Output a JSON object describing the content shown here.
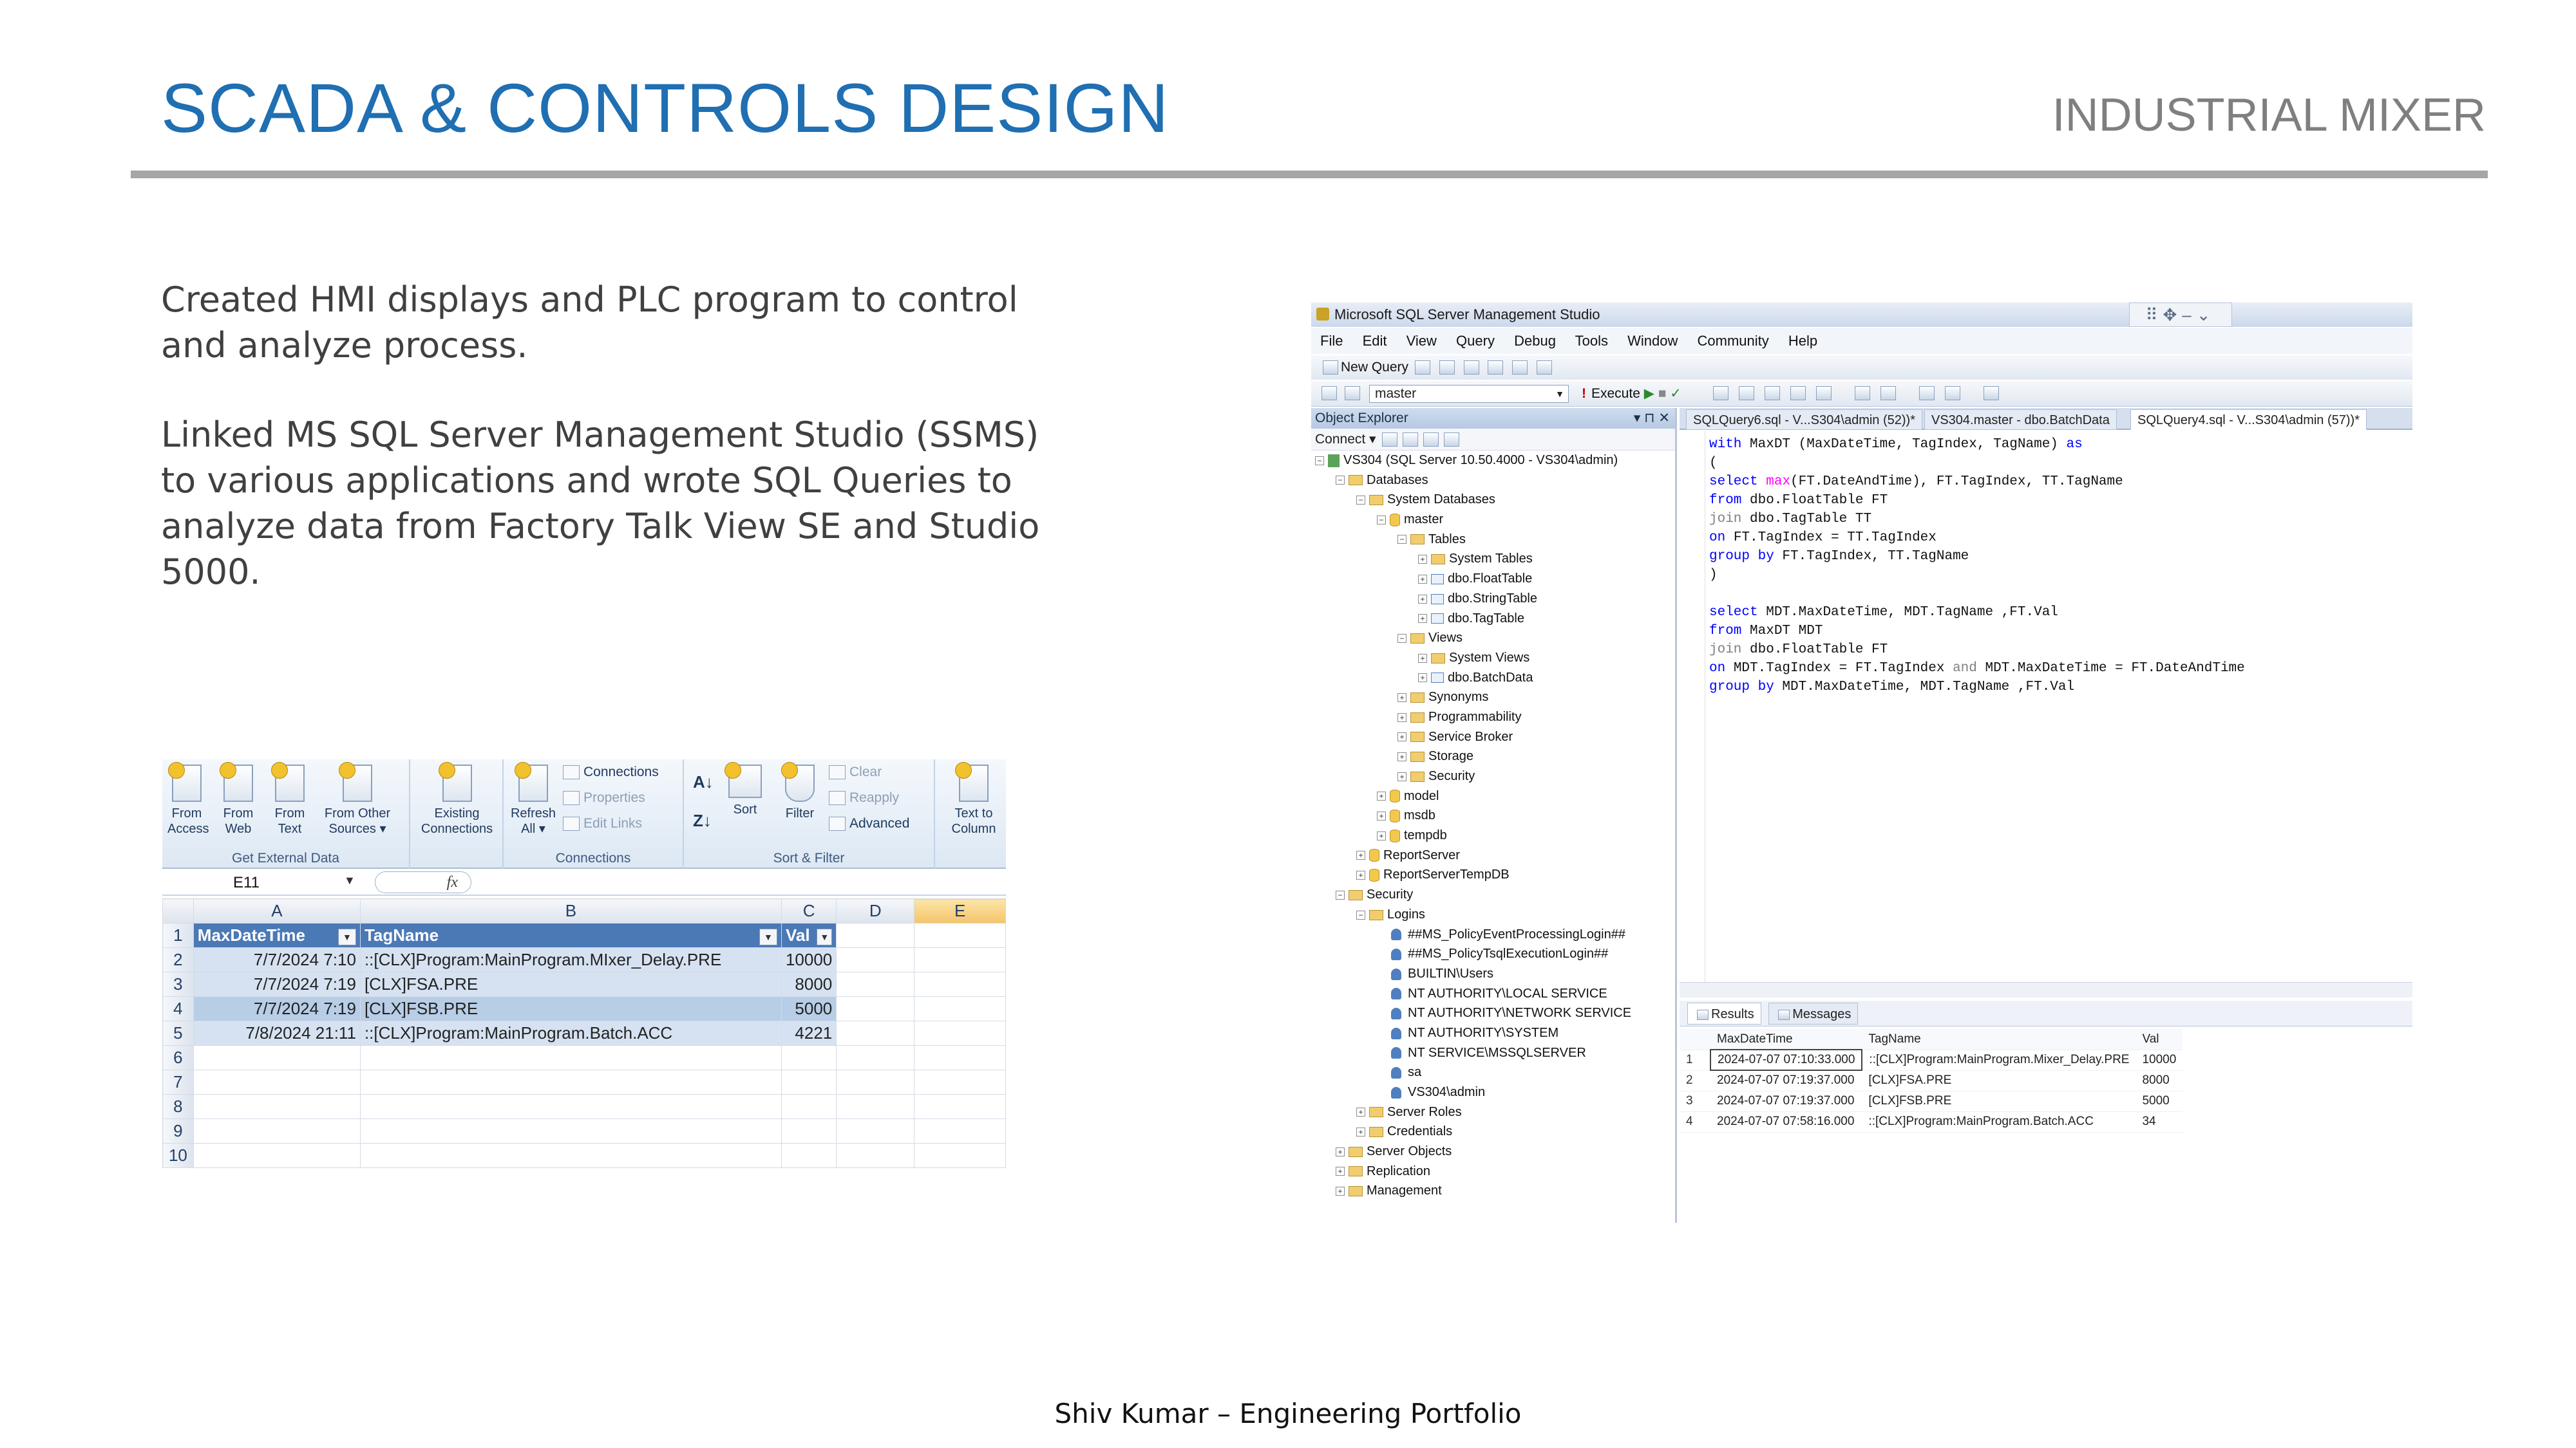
{
  "slide": {
    "title": "SCADA & CONTROLS DESIGN",
    "subtitle": "INDUSTRIAL MIXER",
    "paragraph1": "Created HMI displays and PLC program to control and analyze process.",
    "paragraph2": "Linked MS SQL Server Management Studio (SSMS) to various applications and wrote SQL Queries to analyze data from Factory Talk View SE and Studio 5000.",
    "footer": "Shiv Kumar – Engineering Portfolio"
  },
  "excel": {
    "ribbon": {
      "from_access": "From\nAccess",
      "from_web": "From\nWeb",
      "from_text": "From\nText",
      "from_other": "From Other\nSources ▾",
      "existing_connections": "Existing\nConnections",
      "get_external_label": "Get External Data",
      "refresh_all": "Refresh\nAll ▾",
      "connections": "Connections",
      "properties": "Properties",
      "edit_links": "Edit Links",
      "connections_label": "Connections",
      "sort": "Sort",
      "filter": "Filter",
      "clear": "Clear",
      "reapply": "Reapply",
      "advanced": "Advanced",
      "sort_filter_label": "Sort & Filter",
      "text_to_columns": "Text to\nColumn"
    },
    "name_box": "E11",
    "fx": "fx",
    "columns": [
      "A",
      "B",
      "C",
      "D",
      "E"
    ],
    "headers": [
      "MaxDateTime",
      "TagName",
      "Val"
    ],
    "rows": [
      [
        "7/7/2024 7:10",
        "::[CLX]Program:MainProgram.MIxer_Delay.PRE",
        "10000"
      ],
      [
        "7/7/2024 7:19",
        "[CLX]FSA.PRE",
        "8000"
      ],
      [
        "7/7/2024 7:19",
        "[CLX]FSB.PRE",
        "5000"
      ],
      [
        "7/8/2024 21:11",
        "::[CLX]Program:MainProgram.Batch.ACC",
        "4221"
      ]
    ],
    "row_numbers": [
      "1",
      "2",
      "3",
      "4",
      "5",
      "6",
      "7",
      "8",
      "9",
      "10"
    ]
  },
  "ssms": {
    "window_title": "Microsoft SQL Server Management Studio",
    "menu": [
      "File",
      "Edit",
      "View",
      "Query",
      "Debug",
      "Tools",
      "Window",
      "Community",
      "Help"
    ],
    "new_query": "New Query",
    "database": "master",
    "execute": "Execute",
    "object_explorer": {
      "title": "Object Explorer",
      "connect": "Connect ▾",
      "items": [
        "VS304 (SQL Server 10.50.4000 - VS304\\admin)",
        "Databases",
        "System Databases",
        "master",
        "Tables",
        "System Tables",
        "dbo.FloatTable",
        "dbo.StringTable",
        "dbo.TagTable",
        "Views",
        "System Views",
        "dbo.BatchData",
        "Synonyms",
        "Programmability",
        "Service Broker",
        "Storage",
        "Security",
        "model",
        "msdb",
        "tempdb",
        "ReportServer",
        "ReportServerTempDB",
        "Security",
        "Logins",
        "##MS_PolicyEventProcessingLogin##",
        "##MS_PolicyTsqlExecutionLogin##",
        "BUILTIN\\Users",
        "NT AUTHORITY\\LOCAL SERVICE",
        "NT AUTHORITY\\NETWORK SERVICE",
        "NT AUTHORITY\\SYSTEM",
        "NT SERVICE\\MSSQLSERVER",
        "sa",
        "VS304\\admin",
        "Server Roles",
        "Credentials",
        "Server Objects",
        "Replication",
        "Management"
      ]
    },
    "tabs": [
      "SQLQuery6.sql - V...S304\\admin (52))*",
      "VS304.master - dbo.BatchData",
      "SQLQuery4.sql - V...S304\\admin (57))*"
    ],
    "code": [
      "with MaxDT (MaxDateTime, TagIndex, TagName) as",
      "(",
      "select max(FT.DateAndTime), FT.TagIndex, TT.TagName",
      "from dbo.FloatTable FT",
      "join dbo.TagTable TT",
      "on FT.TagIndex = TT.TagIndex",
      "group by FT.TagIndex, TT.TagName",
      ")",
      "",
      "select MDT.MaxDateTime, MDT.TagName ,FT.Val",
      "from MaxDT MDT",
      "join dbo.FloatTable FT",
      "on MDT.TagIndex = FT.TagIndex and MDT.MaxDateTime = FT.DateAndTime",
      "group by MDT.MaxDateTime, MDT.TagName ,FT.Val"
    ],
    "results_tabs": [
      "Results",
      "Messages"
    ],
    "result_headers": [
      "MaxDateTime",
      "TagName",
      "Val"
    ],
    "result_rows": [
      [
        "1",
        "2024-07-07 07:10:33.000",
        "::[CLX]Program:MainProgram.Mixer_Delay.PRE",
        "10000"
      ],
      [
        "2",
        "2024-07-07 07:19:37.000",
        "[CLX]FSA.PRE",
        "8000"
      ],
      [
        "3",
        "2024-07-07 07:19:37.000",
        "[CLX]FSB.PRE",
        "5000"
      ],
      [
        "4",
        "2024-07-07 07:58:16.000",
        "::[CLX]Program:MainProgram.Batch.ACC",
        "34"
      ]
    ]
  }
}
